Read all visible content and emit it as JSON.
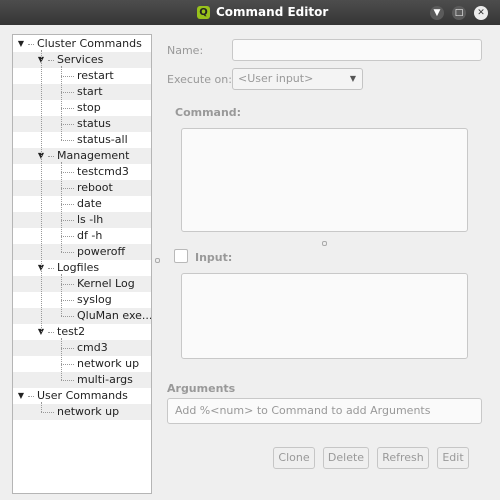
{
  "window": {
    "title": "Command Editor",
    "logo_letter": "Q"
  },
  "tree": [
    {
      "label": "Cluster Commands",
      "level": 0,
      "expanded": true
    },
    {
      "label": "Services",
      "level": 1,
      "expanded": true
    },
    {
      "label": "restart",
      "level": 2
    },
    {
      "label": "start",
      "level": 2
    },
    {
      "label": "stop",
      "level": 2
    },
    {
      "label": "status",
      "level": 2
    },
    {
      "label": "status-all",
      "level": 2
    },
    {
      "label": "Management",
      "level": 1,
      "expanded": true
    },
    {
      "label": "testcmd3",
      "level": 2
    },
    {
      "label": "reboot",
      "level": 2
    },
    {
      "label": "date",
      "level": 2
    },
    {
      "label": "ls -lh",
      "level": 2
    },
    {
      "label": "df -h",
      "level": 2
    },
    {
      "label": "poweroff",
      "level": 2
    },
    {
      "label": "Logfiles",
      "level": 1,
      "expanded": true
    },
    {
      "label": "Kernel Log",
      "level": 2
    },
    {
      "label": "syslog",
      "level": 2
    },
    {
      "label": "QluMan exe...",
      "level": 2
    },
    {
      "label": "test2",
      "level": 1,
      "expanded": true
    },
    {
      "label": "cmd3",
      "level": 2
    },
    {
      "label": "network up",
      "level": 2
    },
    {
      "label": "multi-args",
      "level": 2
    },
    {
      "label": "User Commands",
      "level": 0,
      "expanded": true
    },
    {
      "label": "network up",
      "level": 1
    }
  ],
  "form": {
    "name_label": "Name:",
    "name_value": "",
    "execute_label": "Execute on:",
    "execute_value": "<User input>",
    "command_label": "Command:",
    "command_value": "",
    "input_label": "Input:",
    "input_checked": false,
    "input_value": "",
    "arguments_label": "Arguments",
    "arguments_placeholder": "Add %<num> to Command to add Arguments"
  },
  "buttons": {
    "clone": "Clone",
    "delete": "Delete",
    "refresh": "Refresh",
    "edit": "Edit"
  }
}
